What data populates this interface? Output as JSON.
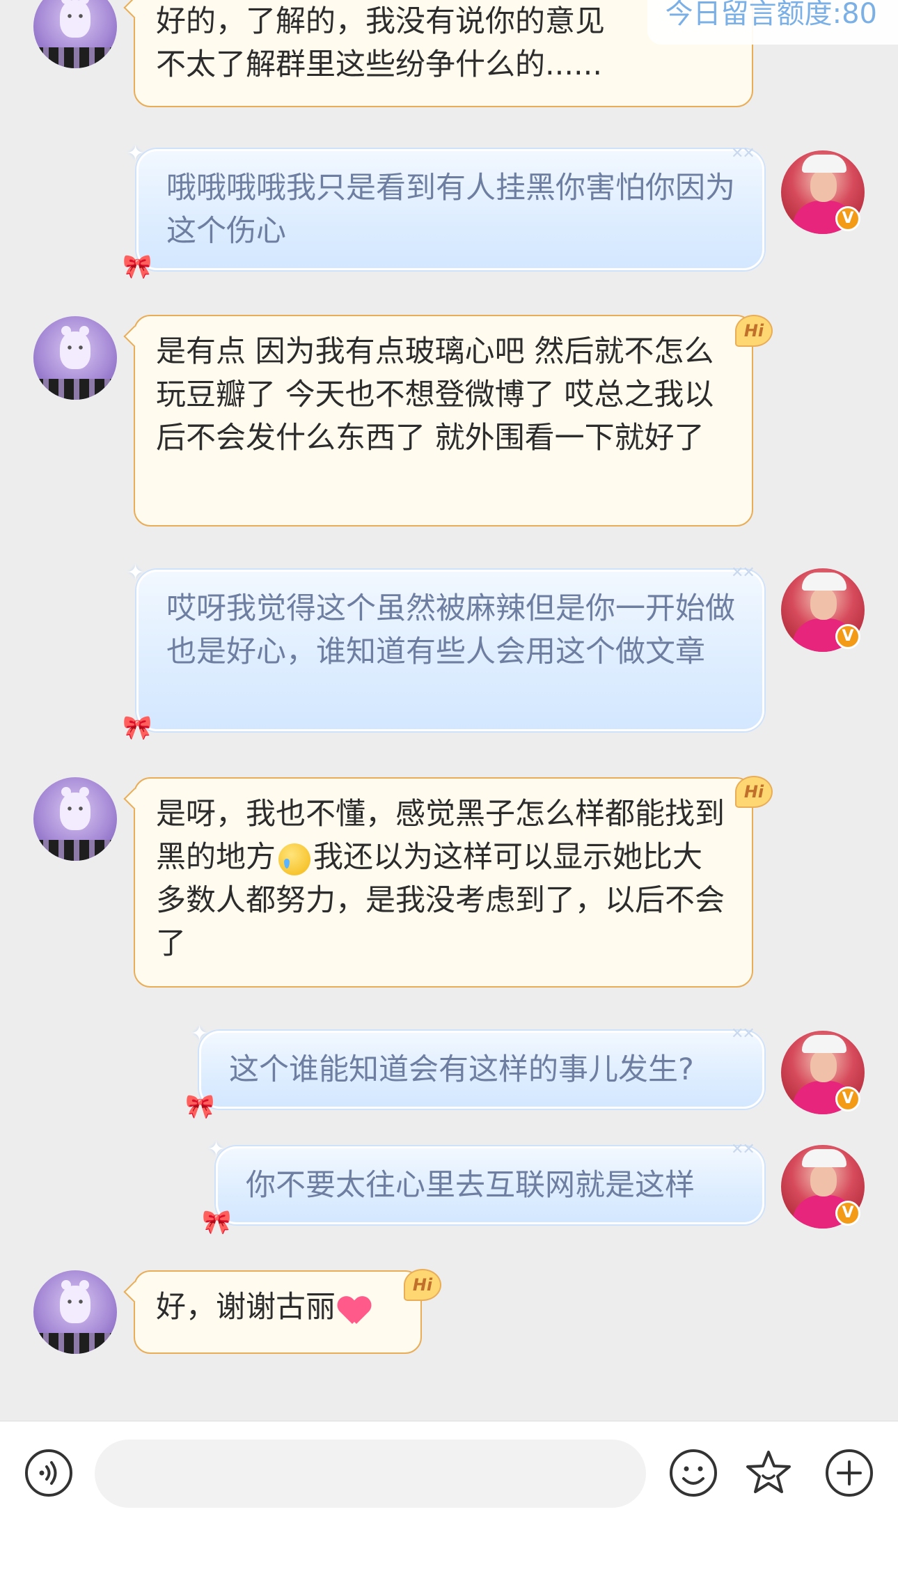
{
  "quota": {
    "text": "今日留言额度:80"
  },
  "messages": [
    {
      "side": "left",
      "text1": "好的，了解的，我没有说你的意见",
      "text2": "不太了解群里这些纷争什么的......"
    },
    {
      "side": "right",
      "text": "哦哦哦哦我只是看到有人挂黑你害怕你因为这个伤心"
    },
    {
      "side": "left",
      "text": "是有点 因为我有点玻璃心吧 然后就不怎么玩豆瓣了 今天也不想登微博了 哎总之我以后不会发什么东西了 就外围看一下就好了"
    },
    {
      "side": "right",
      "text": "哎呀我觉得这个虽然被麻辣但是你一开始做也是好心，谁知道有些人会用这个做文章"
    },
    {
      "side": "left",
      "text_a": "是呀，我也不懂，感觉黑子怎么样都能找到黑的地方",
      "emoji": "crying-face",
      "text_b": "我还以为这样可以显示她比大多数人都努力，是我没考虑到了，以后不会了"
    },
    {
      "side": "right",
      "text": "这个谁能知道会有这样的事儿发生?"
    },
    {
      "side": "right",
      "text": "你不要太往心里去互联网就是这样"
    },
    {
      "side": "left",
      "text": "好，谢谢古丽",
      "emoji": "heart"
    }
  ],
  "badges": {
    "hi": "Hi",
    "verified": "V"
  },
  "input": {
    "placeholder": ""
  },
  "toolbar": [
    "voice-icon",
    "emoji-icon",
    "sticker-icon",
    "add-icon"
  ],
  "colors": {
    "accent": "#e9ad57",
    "bubble_right_text": "#6e7ea0",
    "quota_text": "#7bb0e6"
  }
}
